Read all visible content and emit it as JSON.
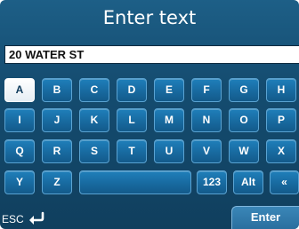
{
  "title": "Enter text",
  "text_field": {
    "value": "20 WATER ST"
  },
  "keyboard": {
    "rows": [
      [
        "A",
        "B",
        "C",
        "D",
        "E",
        "F",
        "G",
        "H"
      ],
      [
        "I",
        "J",
        "K",
        "L",
        "M",
        "N",
        "O",
        "P"
      ],
      [
        "Q",
        "R",
        "S",
        "T",
        "U",
        "V",
        "W",
        "X"
      ]
    ],
    "bottom_row": {
      "y": "Y",
      "z": "Z",
      "space": "",
      "numbers": "123",
      "alt": "Alt",
      "backspace": "«"
    },
    "selected_key": "A"
  },
  "footer": {
    "esc_label": "ESC",
    "esc_icon": "return-arrow-icon",
    "enter_label": "Enter"
  },
  "colors": {
    "background": "#154d71",
    "key": "#186aa0",
    "key_border": "#5aa3d2",
    "selected_key": "#ffffff"
  }
}
